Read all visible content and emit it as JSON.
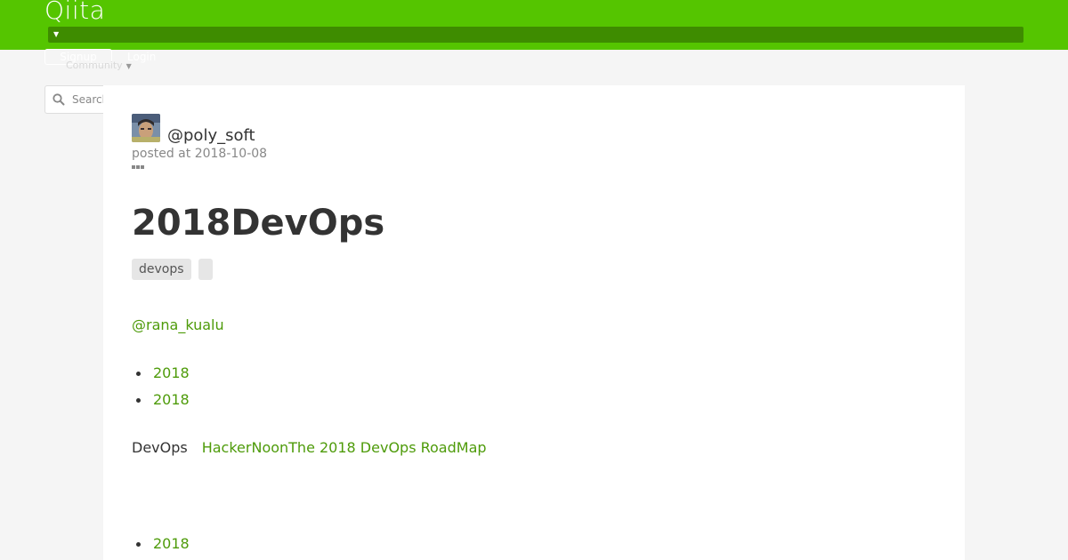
{
  "header": {
    "logo": "Qiita",
    "signup_label": "Signup",
    "login_label": "Login",
    "community_label": "Community",
    "brand_color": "#55c500"
  },
  "search": {
    "placeholder": "Search"
  },
  "article": {
    "author": "@poly_soft",
    "posted": "posted at 2018-10-08",
    "title": "2018DevOps",
    "tags": [
      "devops",
      ""
    ],
    "mention": "@rana_kualu",
    "list1": [
      "2018",
      "2018"
    ],
    "para_text": "DevOps",
    "para_link": "HackerNoonThe 2018 DevOps RoadMap",
    "list2": [
      "2018"
    ],
    "link_color": "#4e9b0a"
  }
}
